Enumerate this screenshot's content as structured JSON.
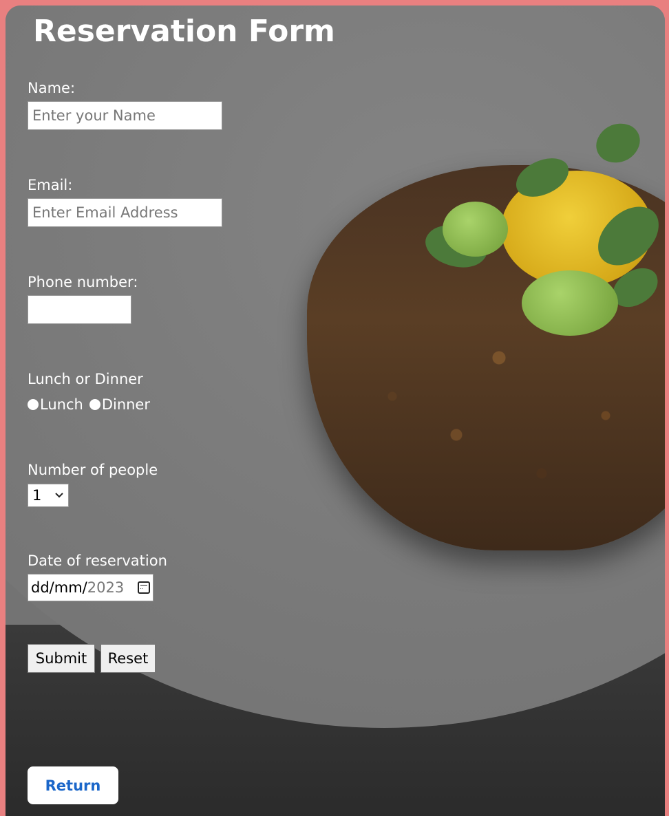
{
  "form": {
    "title": "Reservation Form",
    "name": {
      "label": "Name:",
      "placeholder": "Enter your Name",
      "value": ""
    },
    "email": {
      "label": "Email:",
      "placeholder": "Enter Email Address",
      "value": ""
    },
    "phone": {
      "label": "Phone number:",
      "value": ""
    },
    "meal": {
      "label": "Lunch or Dinner",
      "options": [
        "Lunch",
        "Dinner"
      ]
    },
    "people": {
      "label": "Number of people",
      "selected": "1"
    },
    "date": {
      "label": "Date of reservation",
      "entered": "dd/mm/",
      "year_placeholder": "2023"
    },
    "buttons": {
      "submit": "Submit",
      "reset": "Reset"
    },
    "return_label": "Return"
  }
}
